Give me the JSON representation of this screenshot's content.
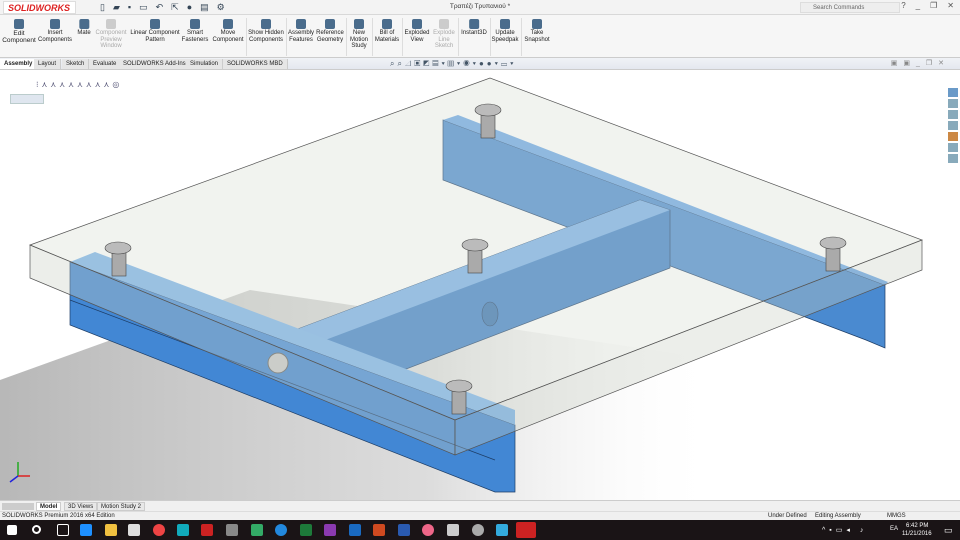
{
  "app": {
    "logo": "SOLIDWORKS",
    "title": "Τραπέζι Τρυπανιού *",
    "search_placeholder": "Search Commands"
  },
  "ribbon": [
    {
      "label": "Edit Component",
      "enabled": true
    },
    {
      "label": "Insert Components",
      "enabled": true
    },
    {
      "label": "Mate",
      "enabled": true
    },
    {
      "label": "Component Preview Window",
      "enabled": false
    },
    {
      "label": "Linear Component Pattern",
      "enabled": true
    },
    {
      "label": "Smart Fasteners",
      "enabled": true
    },
    {
      "label": "Move Component",
      "enabled": true
    },
    {
      "label": "Show Hidden Components",
      "enabled": true
    },
    {
      "label": "Assembly Features",
      "enabled": true
    },
    {
      "label": "Reference Geometry",
      "enabled": true
    },
    {
      "label": "New Motion Study",
      "enabled": true
    },
    {
      "label": "Bill of Materials",
      "enabled": true
    },
    {
      "label": "Exploded View",
      "enabled": true
    },
    {
      "label": "Explode Line Sketch",
      "enabled": false
    },
    {
      "label": "Instant3D",
      "enabled": true
    },
    {
      "label": "Update Speedpak",
      "enabled": true
    },
    {
      "label": "Take Snapshot",
      "enabled": true
    }
  ],
  "tabs": [
    "Assembly",
    "Layout",
    "Sketch",
    "Evaluate",
    "SOLIDWORKS Add-Ins",
    "Simulation",
    "SOLIDWORKS MBD"
  ],
  "bottom_tabs": [
    "Model",
    "3D Views",
    "Motion Study 2"
  ],
  "status": {
    "edition": "SOLIDWORKS Premium 2016 x64 Edition",
    "state": "Under Defined",
    "mode": "Editing Assembly",
    "units": "MMGS"
  },
  "taskbar": {
    "lang": "EA",
    "time": "6:42 PM",
    "date": "11/21/2016"
  },
  "colors": {
    "part": "#3f87d0",
    "accent": "#d22"
  }
}
